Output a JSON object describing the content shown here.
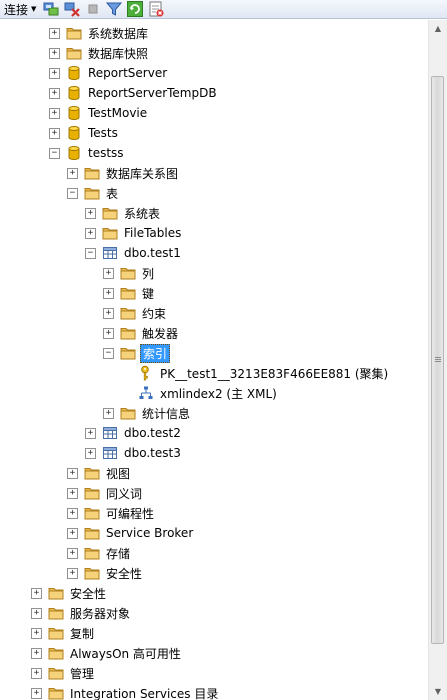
{
  "toolbar": {
    "connect_label": "连接",
    "icons": [
      "connect-object-icon",
      "disconnect-icon",
      "stop-icon",
      "filter-icon",
      "refresh-icon",
      "activity-monitor-icon"
    ]
  },
  "colors": {
    "folder": "#e8b84a",
    "database": "#e8b000",
    "selection": "#3399ff",
    "toolbar": "#dfe7f3"
  },
  "tree": [
    {
      "label": "系统数据库",
      "icon": "folder",
      "depth": 1,
      "state": "collapsed"
    },
    {
      "label": "数据库快照",
      "icon": "folder",
      "depth": 1,
      "state": "collapsed"
    },
    {
      "label": "ReportServer",
      "icon": "database",
      "depth": 1,
      "state": "collapsed"
    },
    {
      "label": "ReportServerTempDB",
      "icon": "database",
      "depth": 1,
      "state": "collapsed"
    },
    {
      "label": "TestMovie",
      "icon": "database",
      "depth": 1,
      "state": "collapsed"
    },
    {
      "label": "Tests",
      "icon": "database",
      "depth": 1,
      "state": "collapsed"
    },
    {
      "label": "testss",
      "icon": "database",
      "depth": 1,
      "state": "expanded"
    },
    {
      "label": "数据库关系图",
      "icon": "folder",
      "depth": 2,
      "state": "collapsed"
    },
    {
      "label": "表",
      "icon": "folder",
      "depth": 2,
      "state": "expanded"
    },
    {
      "label": "系统表",
      "icon": "folder",
      "depth": 3,
      "state": "collapsed"
    },
    {
      "label": "FileTables",
      "icon": "folder",
      "depth": 3,
      "state": "collapsed"
    },
    {
      "label": "dbo.test1",
      "icon": "table",
      "depth": 3,
      "state": "expanded"
    },
    {
      "label": "列",
      "icon": "folder",
      "depth": 4,
      "state": "collapsed"
    },
    {
      "label": "键",
      "icon": "folder",
      "depth": 4,
      "state": "collapsed"
    },
    {
      "label": "约束",
      "icon": "folder",
      "depth": 4,
      "state": "collapsed"
    },
    {
      "label": "触发器",
      "icon": "folder",
      "depth": 4,
      "state": "collapsed"
    },
    {
      "label": "索引",
      "icon": "folder",
      "depth": 4,
      "state": "expanded",
      "selected": true
    },
    {
      "label": "PK__test1__3213E83F466EE881 (聚集)",
      "icon": "key",
      "depth": 5,
      "state": "none"
    },
    {
      "label": "xmlindex2 (主 XML)",
      "icon": "xml-index",
      "depth": 5,
      "state": "none"
    },
    {
      "label": "统计信息",
      "icon": "folder",
      "depth": 4,
      "state": "collapsed"
    },
    {
      "label": "dbo.test2",
      "icon": "table",
      "depth": 3,
      "state": "collapsed"
    },
    {
      "label": "dbo.test3",
      "icon": "table",
      "depth": 3,
      "state": "collapsed"
    },
    {
      "label": "视图",
      "icon": "folder",
      "depth": 2,
      "state": "collapsed"
    },
    {
      "label": "同义词",
      "icon": "folder",
      "depth": 2,
      "state": "collapsed"
    },
    {
      "label": "可编程性",
      "icon": "folder",
      "depth": 2,
      "state": "collapsed"
    },
    {
      "label": "Service Broker",
      "icon": "folder",
      "depth": 2,
      "state": "collapsed"
    },
    {
      "label": "存储",
      "icon": "folder",
      "depth": 2,
      "state": "collapsed"
    },
    {
      "label": "安全性",
      "icon": "folder",
      "depth": 2,
      "state": "collapsed"
    },
    {
      "label": "安全性",
      "icon": "folder",
      "depth": 0,
      "state": "collapsed"
    },
    {
      "label": "服务器对象",
      "icon": "folder",
      "depth": 0,
      "state": "collapsed"
    },
    {
      "label": "复制",
      "icon": "folder",
      "depth": 0,
      "state": "collapsed"
    },
    {
      "label": "AlwaysOn 高可用性",
      "icon": "folder",
      "depth": 0,
      "state": "collapsed"
    },
    {
      "label": "管理",
      "icon": "folder",
      "depth": 0,
      "state": "collapsed"
    },
    {
      "label": "Integration Services 目录",
      "icon": "folder",
      "depth": 0,
      "state": "collapsed"
    }
  ]
}
